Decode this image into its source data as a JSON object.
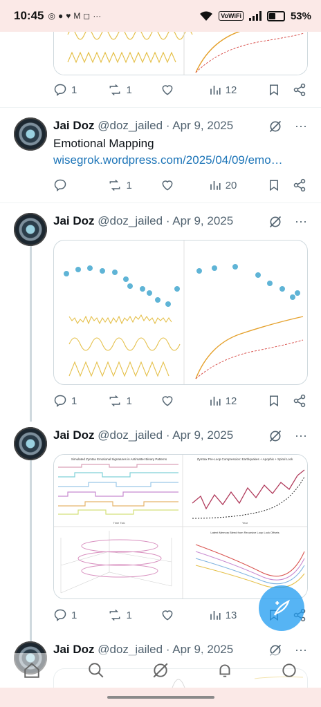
{
  "status": {
    "time": "10:45",
    "vowifi": "VoWiFi",
    "battery": "53%"
  },
  "posts": [
    {
      "stats": {
        "replies": "1",
        "reposts": "1",
        "views": "12"
      }
    },
    {
      "name": "Jai Doz",
      "handle": "@doz_jailed",
      "dot": "·",
      "date": "Apr 9, 2025",
      "text": "Emotional Mapping",
      "link": "wisegrok.wordpress.com/2025/04/09/emo…",
      "stats": {
        "replies": "",
        "reposts": "1",
        "views": "20"
      }
    },
    {
      "name": "Jai Doz",
      "handle": "@doz_jailed",
      "dot": "·",
      "date": "Apr 9, 2025",
      "stats": {
        "replies": "1",
        "reposts": "1",
        "views": "12"
      }
    },
    {
      "name": "Jai Doz",
      "handle": "@doz_jailed",
      "dot": "·",
      "date": "Apr 9, 2025",
      "media_titles": {
        "left": "Simulated Zymtax Emotional Signatures in Antimatter Binary Patterns",
        "right": "Zymtax Pre-Loop Compression: Earthquakes + Apophis + Spiral Lock",
        "bottom_right": "Latent Memory Bleed from Recursive Loop Lock Offsets",
        "xlabel_left": "Time Tick",
        "xlabel_right": "Year"
      },
      "stats": {
        "replies": "1",
        "reposts": "1",
        "views": "13"
      }
    },
    {
      "name": "Jai Doz",
      "handle": "@doz_jailed",
      "dot": "·",
      "date": "Apr 9, 2025"
    }
  ],
  "icons": {
    "reply": "reply-icon",
    "repost": "repost-icon",
    "like": "heart-icon",
    "views": "views-icon",
    "bookmark": "bookmark-icon",
    "share": "share-icon",
    "grok": "grok-icon",
    "more": "more-icon"
  },
  "colors": {
    "link": "#1d75b8",
    "fab": "#1d9bf0",
    "status_bg": "#fbe9e7"
  }
}
